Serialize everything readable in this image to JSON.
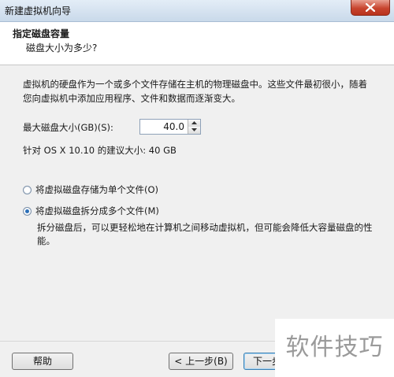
{
  "window": {
    "title": "新建虚拟机向导"
  },
  "header": {
    "title": "指定磁盘容量",
    "subtitle": "磁盘大小为多少?"
  },
  "description": "虚拟机的硬盘作为一个或多个文件存储在主机的物理磁盘中。这些文件最初很小，随着您向虚拟机中添加应用程序、文件和数据而逐渐变大。",
  "disk_size": {
    "label": "最大磁盘大小(GB)(S):",
    "value": "40.0"
  },
  "recommended": "针对 OS X 10.10 的建议大小: 40 GB",
  "options": [
    {
      "label": "将虚拟磁盘存储为单个文件(O)",
      "checked": false
    },
    {
      "label": "将虚拟磁盘拆分成多个文件(M)",
      "checked": true
    }
  ],
  "split_description": "拆分磁盘后，可以更轻松地在计算机之间移动虚拟机，但可能会降低大容量磁盘的性能。",
  "buttons": {
    "help": "帮助",
    "back": "< 上一步(B)",
    "next": "下一步"
  },
  "watermark": "软件技巧"
}
